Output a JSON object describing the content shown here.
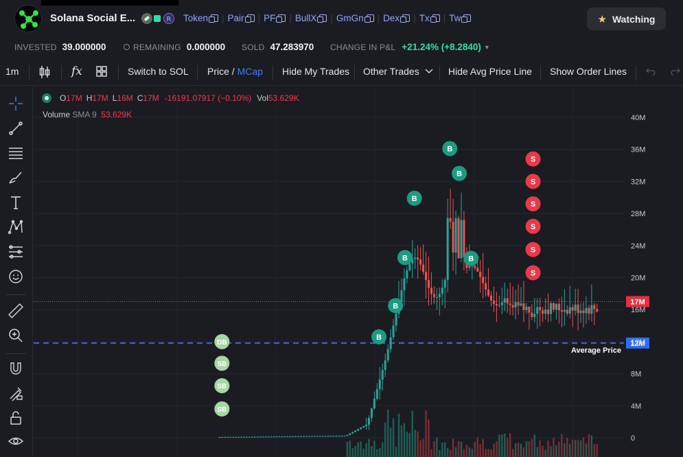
{
  "header": {
    "title": "Solana Social E...",
    "links": [
      "Token",
      "Pair",
      "PF",
      "BullX",
      "GmGn",
      "Dex",
      "Tx",
      "Tw"
    ],
    "watch_label": "Watching",
    "star_icon": "★"
  },
  "stats": {
    "invested_label": "INVESTED",
    "invested": "39.000000",
    "remaining_label": "REMAINING",
    "remaining": "0.000000",
    "sold_label": "SOLD",
    "sold": "47.283970",
    "change_label": "CHANGE IN P&L",
    "change": "+21.24% (+8.2840)"
  },
  "toolbar": {
    "interval": "1m",
    "switch": "Switch to SOL",
    "price_label": "Price /",
    "mcap_label": "MCap",
    "hide_trades": "Hide My Trades",
    "other_trades": "Other Trades",
    "hide_avg": "Hide Avg Price Line",
    "show_orders": "Show Order Lines",
    "fx_label": "fx"
  },
  "legend": {
    "o_label": "O",
    "o": "17M",
    "h_label": "H",
    "h": "17M",
    "l_label": "L",
    "l": "16M",
    "c_label": "C",
    "c": "17M",
    "delta": "-16191.07917 (−0.10%)",
    "vol_label": "Vol",
    "vol": "53.629K",
    "volume_title": "Volume",
    "sma": "SMA 9",
    "sma_value": "53.629K"
  },
  "chart_data": {
    "type": "candlestick",
    "y_axis_ticks": [
      "40M",
      "36M",
      "32M",
      "28M",
      "24M",
      "20M",
      "16M",
      "12M",
      "8M",
      "4M",
      "0"
    ],
    "current_price_label": "17M",
    "current_price": 17,
    "average_price_label": "12M",
    "average_price": 12,
    "average_price_text": "Average Price",
    "trade_markers": [
      {
        "label": "DB",
        "price": 12.0,
        "t": 0.319
      },
      {
        "label": "SB",
        "price": 9.3,
        "t": 0.319
      },
      {
        "label": "SB",
        "price": 6.5,
        "t": 0.319
      },
      {
        "label": "SB",
        "price": 3.6,
        "t": 0.319
      },
      {
        "label": "B",
        "price": 12.6,
        "t": 0.585
      },
      {
        "label": "B",
        "price": 16.5,
        "t": 0.613
      },
      {
        "label": "B",
        "price": 22.5,
        "t": 0.629
      },
      {
        "label": "B",
        "price": 29.9,
        "t": 0.645
      },
      {
        "label": "B",
        "price": 36.1,
        "t": 0.705
      },
      {
        "label": "B",
        "price": 33.0,
        "t": 0.721
      },
      {
        "label": "B",
        "price": 22.4,
        "t": 0.741
      },
      {
        "label": "S",
        "price": 34.8,
        "t": 0.846
      },
      {
        "label": "S",
        "price": 32.0,
        "t": 0.846
      },
      {
        "label": "S",
        "price": 29.2,
        "t": 0.846
      },
      {
        "label": "S",
        "price": 26.4,
        "t": 0.846
      },
      {
        "label": "S",
        "price": 23.5,
        "t": 0.846
      },
      {
        "label": "S",
        "price": 20.6,
        "t": 0.846
      }
    ],
    "colors": {
      "up": "#26a69a",
      "down": "#ef5350",
      "buy": "#1d9b82",
      "sell": "#e83a4a",
      "self_buy": "#a6d6a3",
      "avg_line": "#3f7cf6"
    }
  }
}
